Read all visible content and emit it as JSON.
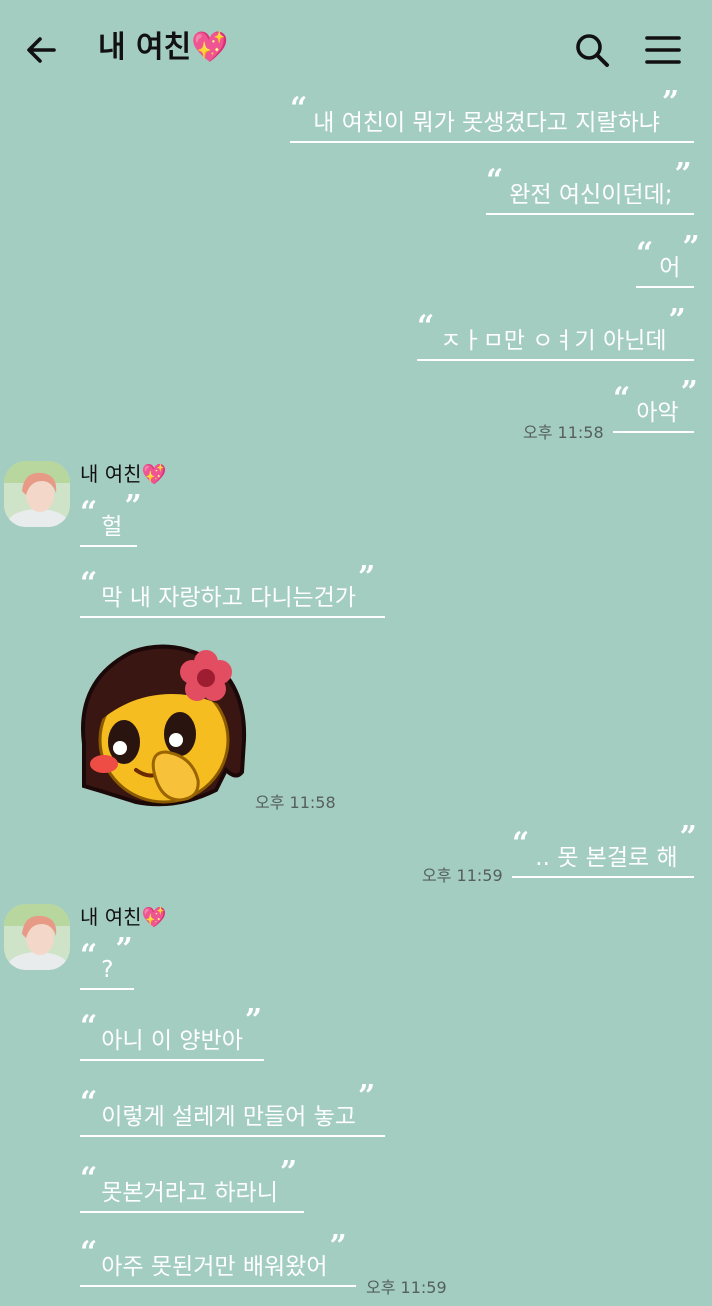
{
  "header": {
    "back_icon": "arrow-left-icon",
    "title": "내 여친💖",
    "search_icon": "search-icon",
    "menu_icon": "hamburger-menu-icon"
  },
  "quote_open": "“",
  "quote_close": "”",
  "messages": [
    {
      "text": "내 여친이 뭐가 못생겼다고 지랄하냐",
      "side": "right"
    },
    {
      "text": "완전 여신이던데;",
      "side": "right"
    },
    {
      "text": "어",
      "side": "right"
    },
    {
      "text": "ㅈㅏㅁ만 ㅇㅕ기 아닌데",
      "side": "right"
    },
    {
      "text": "아악",
      "side": "right",
      "time": "오후 11:58"
    },
    {
      "text": "헐",
      "side": "left",
      "sender": "내 여친💖"
    },
    {
      "text": "막 내 자랑하고 다니는건가",
      "side": "left"
    },
    {
      "text": "",
      "side": "left",
      "sticker": "shy-girl-emoji-sticker",
      "time": "오후 11:58"
    },
    {
      "text": ".. 못 본걸로 해",
      "side": "right",
      "time": "오후 11:59"
    },
    {
      "text": "?",
      "side": "left",
      "sender": "내 여친💖"
    },
    {
      "text": "아니 이 양반아",
      "side": "left"
    },
    {
      "text": "이렇게 설레게 만들어 놓고",
      "side": "left"
    },
    {
      "text": "못본거라고 하라니",
      "side": "left"
    },
    {
      "text": "아주 못된거만 배워왔어",
      "side": "left",
      "time": "오후 11:59"
    }
  ],
  "colors": {
    "background": "#a4cdc1",
    "message_text": "#ffffff",
    "timestamp": "#555f5c",
    "header_text": "#111111"
  }
}
